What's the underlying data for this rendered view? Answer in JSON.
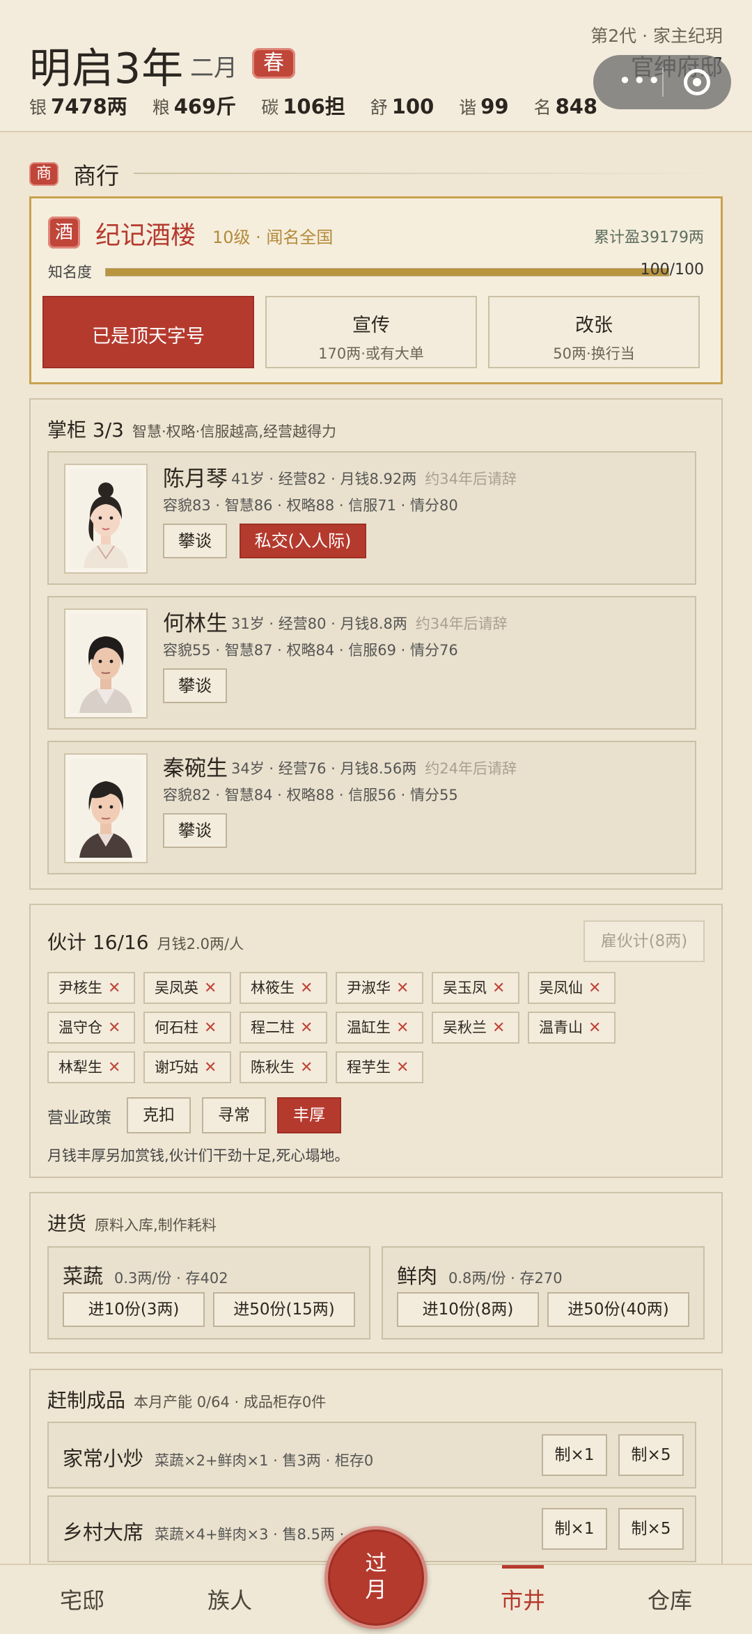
{
  "header": {
    "year": "明启3年",
    "month": "二月",
    "season": "春",
    "generation": "第2代 · 家主纪玥",
    "title": "官绅府邸",
    "stats": [
      {
        "label": "银",
        "value": "7478两"
      },
      {
        "label": "粮",
        "value": "469斤"
      },
      {
        "label": "碳",
        "value": "106担"
      },
      {
        "label": "舒",
        "value": "100"
      },
      {
        "label": "谐",
        "value": "99"
      },
      {
        "label": "名",
        "value": "848"
      }
    ]
  },
  "section": {
    "seal": "商",
    "title": "商行"
  },
  "shop": {
    "seal": "酒",
    "name": "纪记酒楼",
    "level": "10级 · 闻名全国",
    "profit": "累计盈39179两",
    "fame_label": "知名度",
    "fame_value": "100/100",
    "fame_fraction": 1.0,
    "buttons": [
      {
        "line1": "已是顶天字号",
        "line2": ""
      },
      {
        "line1": "宣传",
        "line2": "170两·或有大单"
      },
      {
        "line1": "改张",
        "line2": "50两·换行当"
      }
    ]
  },
  "managers": {
    "title": "掌柜 3/3",
    "hint": "智慧·权略·信服越高,经营越得力",
    "list": [
      {
        "name": "陈月琴",
        "detail": "41岁 · 经营82 · 月钱8.92两",
        "resign": "约34年后请辞",
        "attrs": "容貌83 · 智慧86 · 权略88 · 信服71 · 情分80",
        "talk": "攀谈",
        "social": "私交(入人际)"
      },
      {
        "name": "何林生",
        "detail": "31岁 · 经营80 · 月钱8.8两",
        "resign": "约34年后请辞",
        "attrs": "容貌55 · 智慧87 · 权略84 · 信服69 · 情分76",
        "talk": "攀谈"
      },
      {
        "name": "秦碗生",
        "detail": "34岁 · 经营76 · 月钱8.56两",
        "resign": "约24年后请辞",
        "attrs": "容貌82 · 智慧84 · 权略88 · 信服56 · 情分55",
        "talk": "攀谈"
      }
    ]
  },
  "staff": {
    "title": "伙计 16/16",
    "hint": "月钱2.0两/人",
    "hire": "雇伙计(8两)",
    "names": [
      "尹核生",
      "吴凤英",
      "林筱生",
      "尹淑华",
      "吴玉凤",
      "吴凤仙",
      "温守仓",
      "何石柱",
      "程二柱",
      "温缸生",
      "吴秋兰",
      "温青山",
      "林犁生",
      "谢巧姑",
      "陈秋生",
      "程芋生"
    ],
    "policy_label": "营业政策",
    "policies": [
      "克扣",
      "寻常",
      "丰厚"
    ],
    "policy_desc": "月钱丰厚另加赏钱,伙计们干劲十足,死心塌地。"
  },
  "purchase": {
    "title": "进货",
    "hint": "原料入库,制作耗料",
    "items": [
      {
        "name": "菜蔬",
        "detail": "0.3两/份 · 存402",
        "b1": "进10份(3两)",
        "b2": "进50份(15两)"
      },
      {
        "name": "鲜肉",
        "detail": "0.8两/份 · 存270",
        "b1": "进10份(8两)",
        "b2": "进50份(40两)"
      }
    ]
  },
  "produce": {
    "title": "赶制成品",
    "hint": "本月产能 0/64 · 成品柜存0件",
    "items": [
      {
        "name": "家常小炒",
        "detail": "菜蔬×2+鲜肉×1 · 售3两 · 柜存0",
        "b1": "制×1",
        "b2": "制×5"
      },
      {
        "name": "乡村大席",
        "detail": "菜蔬×4+鲜肉×3 · 售8.5两 ·",
        "b1": "制×1",
        "b2": "制×5"
      }
    ]
  },
  "nav": {
    "items": [
      "宅邸",
      "族人",
      "市井",
      "仓库"
    ],
    "pass_top": "过",
    "pass_bottom": "月"
  },
  "colors": {
    "accent": "#b53a2e",
    "gold": "#c9a24f",
    "background": "#efe6d4"
  }
}
